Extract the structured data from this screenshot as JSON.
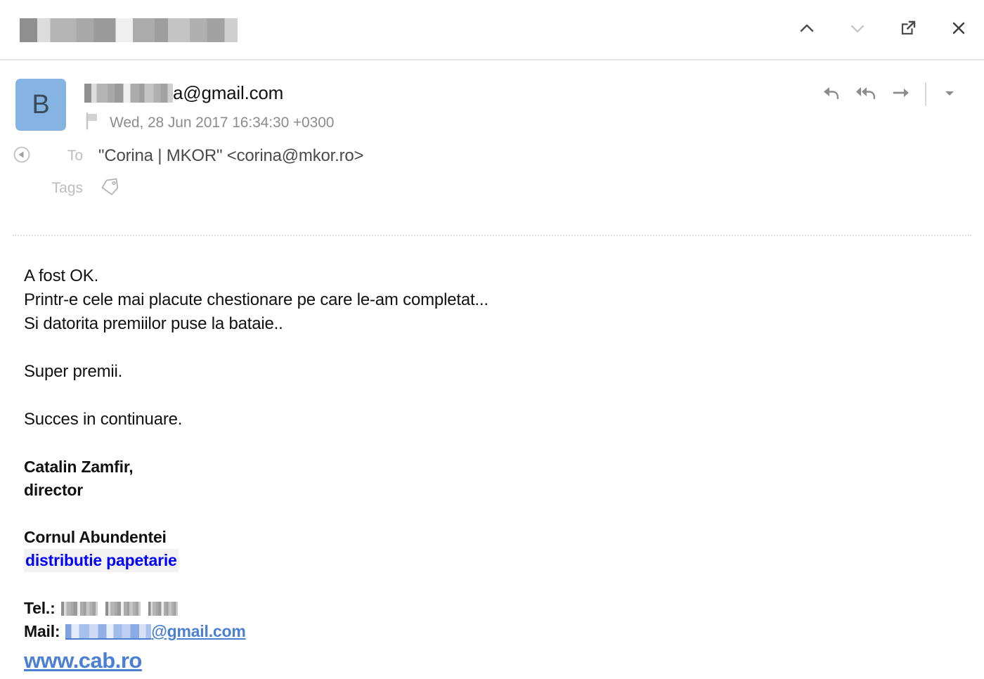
{
  "window": {
    "title_redacted": true,
    "title_text": "",
    "actions": [
      {
        "name": "previous-message",
        "label": "Previous message",
        "icon": "chevron-up-icon",
        "enabled": true
      },
      {
        "name": "next-message",
        "label": "Next message",
        "icon": "chevron-down-icon",
        "enabled": false
      },
      {
        "name": "open-in-new-window",
        "label": "Open in new window",
        "icon": "external-link-icon",
        "enabled": true
      },
      {
        "name": "close",
        "label": "Close",
        "icon": "close-icon",
        "enabled": true
      }
    ]
  },
  "header": {
    "avatar_initial": "B",
    "avatar_color": "#85b3e2",
    "sender_redacted": true,
    "sender_address_visible": "a@gmail.com",
    "date": "Wed, 28 Jun 2017 16:34:30 +0300",
    "flag_icon": "flag-icon",
    "to_label": "To",
    "to_value": "\"Corina | MKOR\" <corina@mkor.ro>",
    "tags_label": "Tags",
    "tags_value": "",
    "tags_icon": "tag-icon",
    "expand_icon": "collapse-toggle-icon",
    "reply_actions": [
      {
        "name": "reply",
        "label": "Reply",
        "icon": "reply-icon"
      },
      {
        "name": "reply-all",
        "label": "Reply all",
        "icon": "reply-all-icon"
      },
      {
        "name": "forward",
        "label": "Forward",
        "icon": "forward-icon"
      },
      {
        "name": "more",
        "label": "More actions",
        "icon": "caret-down-icon"
      }
    ]
  },
  "body": {
    "line1": "A fost OK.",
    "line2": "Printr-e cele mai placute chestionare pe care le-am completat...",
    "line3": "Si datorita premiilor puse la bataie..",
    "line4": "Super premii.",
    "line5": "Succes in continuare."
  },
  "signature": {
    "name": "Catalin Zamfir,",
    "role": "director",
    "company": "Cornul Abundentei",
    "tagline": "distributie papetarie",
    "tagline_color": "#0000ff",
    "tel_label": "Tel.:",
    "tel_value_redacted": true,
    "mail_label": "Mail:",
    "mail_redacted": true,
    "mail_visible": "@gmail.com",
    "website": "www.cab.ro",
    "link_color": "#4a7fd4"
  }
}
